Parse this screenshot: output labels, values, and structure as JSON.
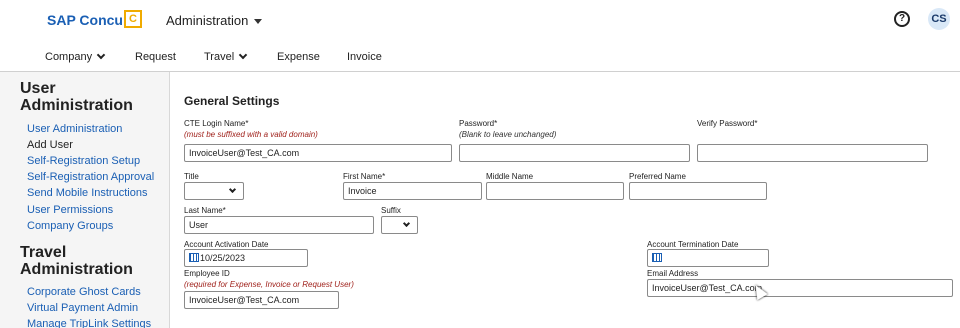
{
  "header": {
    "brand": "SAP Concur",
    "brand_logo": "C",
    "admin_menu": "Administration",
    "help_icon": "?",
    "avatar": "CS"
  },
  "nav": {
    "company": "Company",
    "request": "Request",
    "travel": "Travel",
    "expense": "Expense",
    "invoice": "Invoice"
  },
  "sidebar": {
    "user_admin_heading_1": "User",
    "user_admin_heading_2": "Administration",
    "user_links": [
      "User Administration",
      "Add User",
      "Self-Registration Setup",
      "Self-Registration Approval",
      "Send Mobile Instructions",
      "User Permissions",
      "Company Groups"
    ],
    "travel_admin_heading_1": "Travel",
    "travel_admin_heading_2": "Administration",
    "travel_links": [
      "Corporate Ghost Cards",
      "Virtual Payment Admin",
      "Manage TripLink Settings"
    ]
  },
  "form": {
    "title": "General Settings",
    "cte_login_label": "CTE Login Name*",
    "cte_login_hint": "(must be suffixed with a valid domain)",
    "cte_login_value": "InvoiceUser@Test_CA.com",
    "password_label": "Password*",
    "password_hint": "(Blank to leave unchanged)",
    "password_value": "",
    "verify_password_label": "Verify Password*",
    "verify_password_value": "",
    "title_label": "Title",
    "title_value": "",
    "first_name_label": "First Name*",
    "first_name_value": "Invoice",
    "middle_name_label": "Middle Name",
    "middle_name_value": "",
    "preferred_name_label": "Preferred Name",
    "preferred_name_value": "",
    "last_name_label": "Last Name*",
    "last_name_value": "User",
    "suffix_label": "Suffix",
    "suffix_value": "",
    "activation_label": "Account Activation Date",
    "activation_value": "10/25/2023",
    "termination_label": "Account Termination Date",
    "termination_value": "",
    "employee_id_label": "Employee ID",
    "employee_id_hint": "(required for Expense, Invoice or Request User)",
    "employee_id_value": "InvoiceUser@Test_CA.com",
    "email_label": "Email Address",
    "email_value": "InvoiceUser@Test_CA.com"
  }
}
